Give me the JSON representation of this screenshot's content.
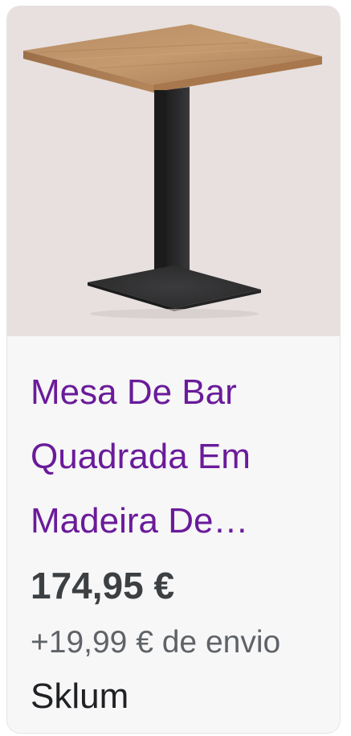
{
  "product": {
    "title": "Mesa De Bar\nQuadrada Em\nMadeira De…",
    "price": "174,95 €",
    "shipping": "+19,99 € de envio",
    "seller": "Sklum",
    "image_icon": "bar-table-image"
  },
  "colors": {
    "title": "#6a1b9a",
    "price": "#3c4043",
    "background": "#f7f7f7",
    "image_background": "#e7e0de"
  }
}
